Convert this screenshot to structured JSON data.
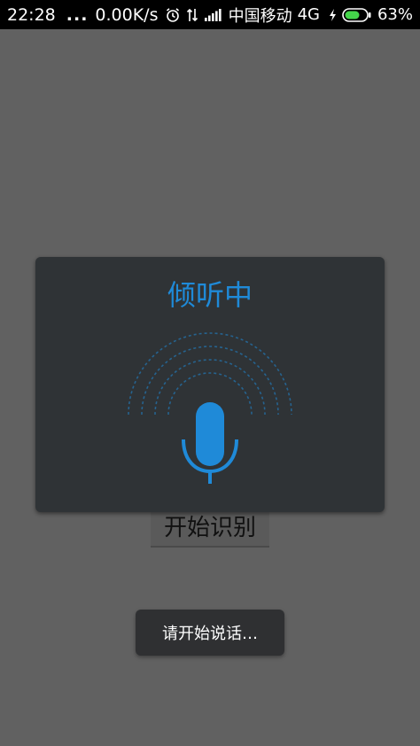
{
  "status_bar": {
    "time": "22:28",
    "dots": "...",
    "speed": "0.00K/s",
    "carrier": "中国移动",
    "network": "4G",
    "battery_percent": "63%",
    "icons": [
      "alarm-icon",
      "data-transfer-icon",
      "signal-icon",
      "charging-icon",
      "battery-icon"
    ]
  },
  "dialog": {
    "title": "倾听中",
    "accent_color": "#1f8ad8",
    "icon": "microphone-icon"
  },
  "main": {
    "start_button_label": "开始识别"
  },
  "toast": {
    "message": "请开始说话…"
  }
}
